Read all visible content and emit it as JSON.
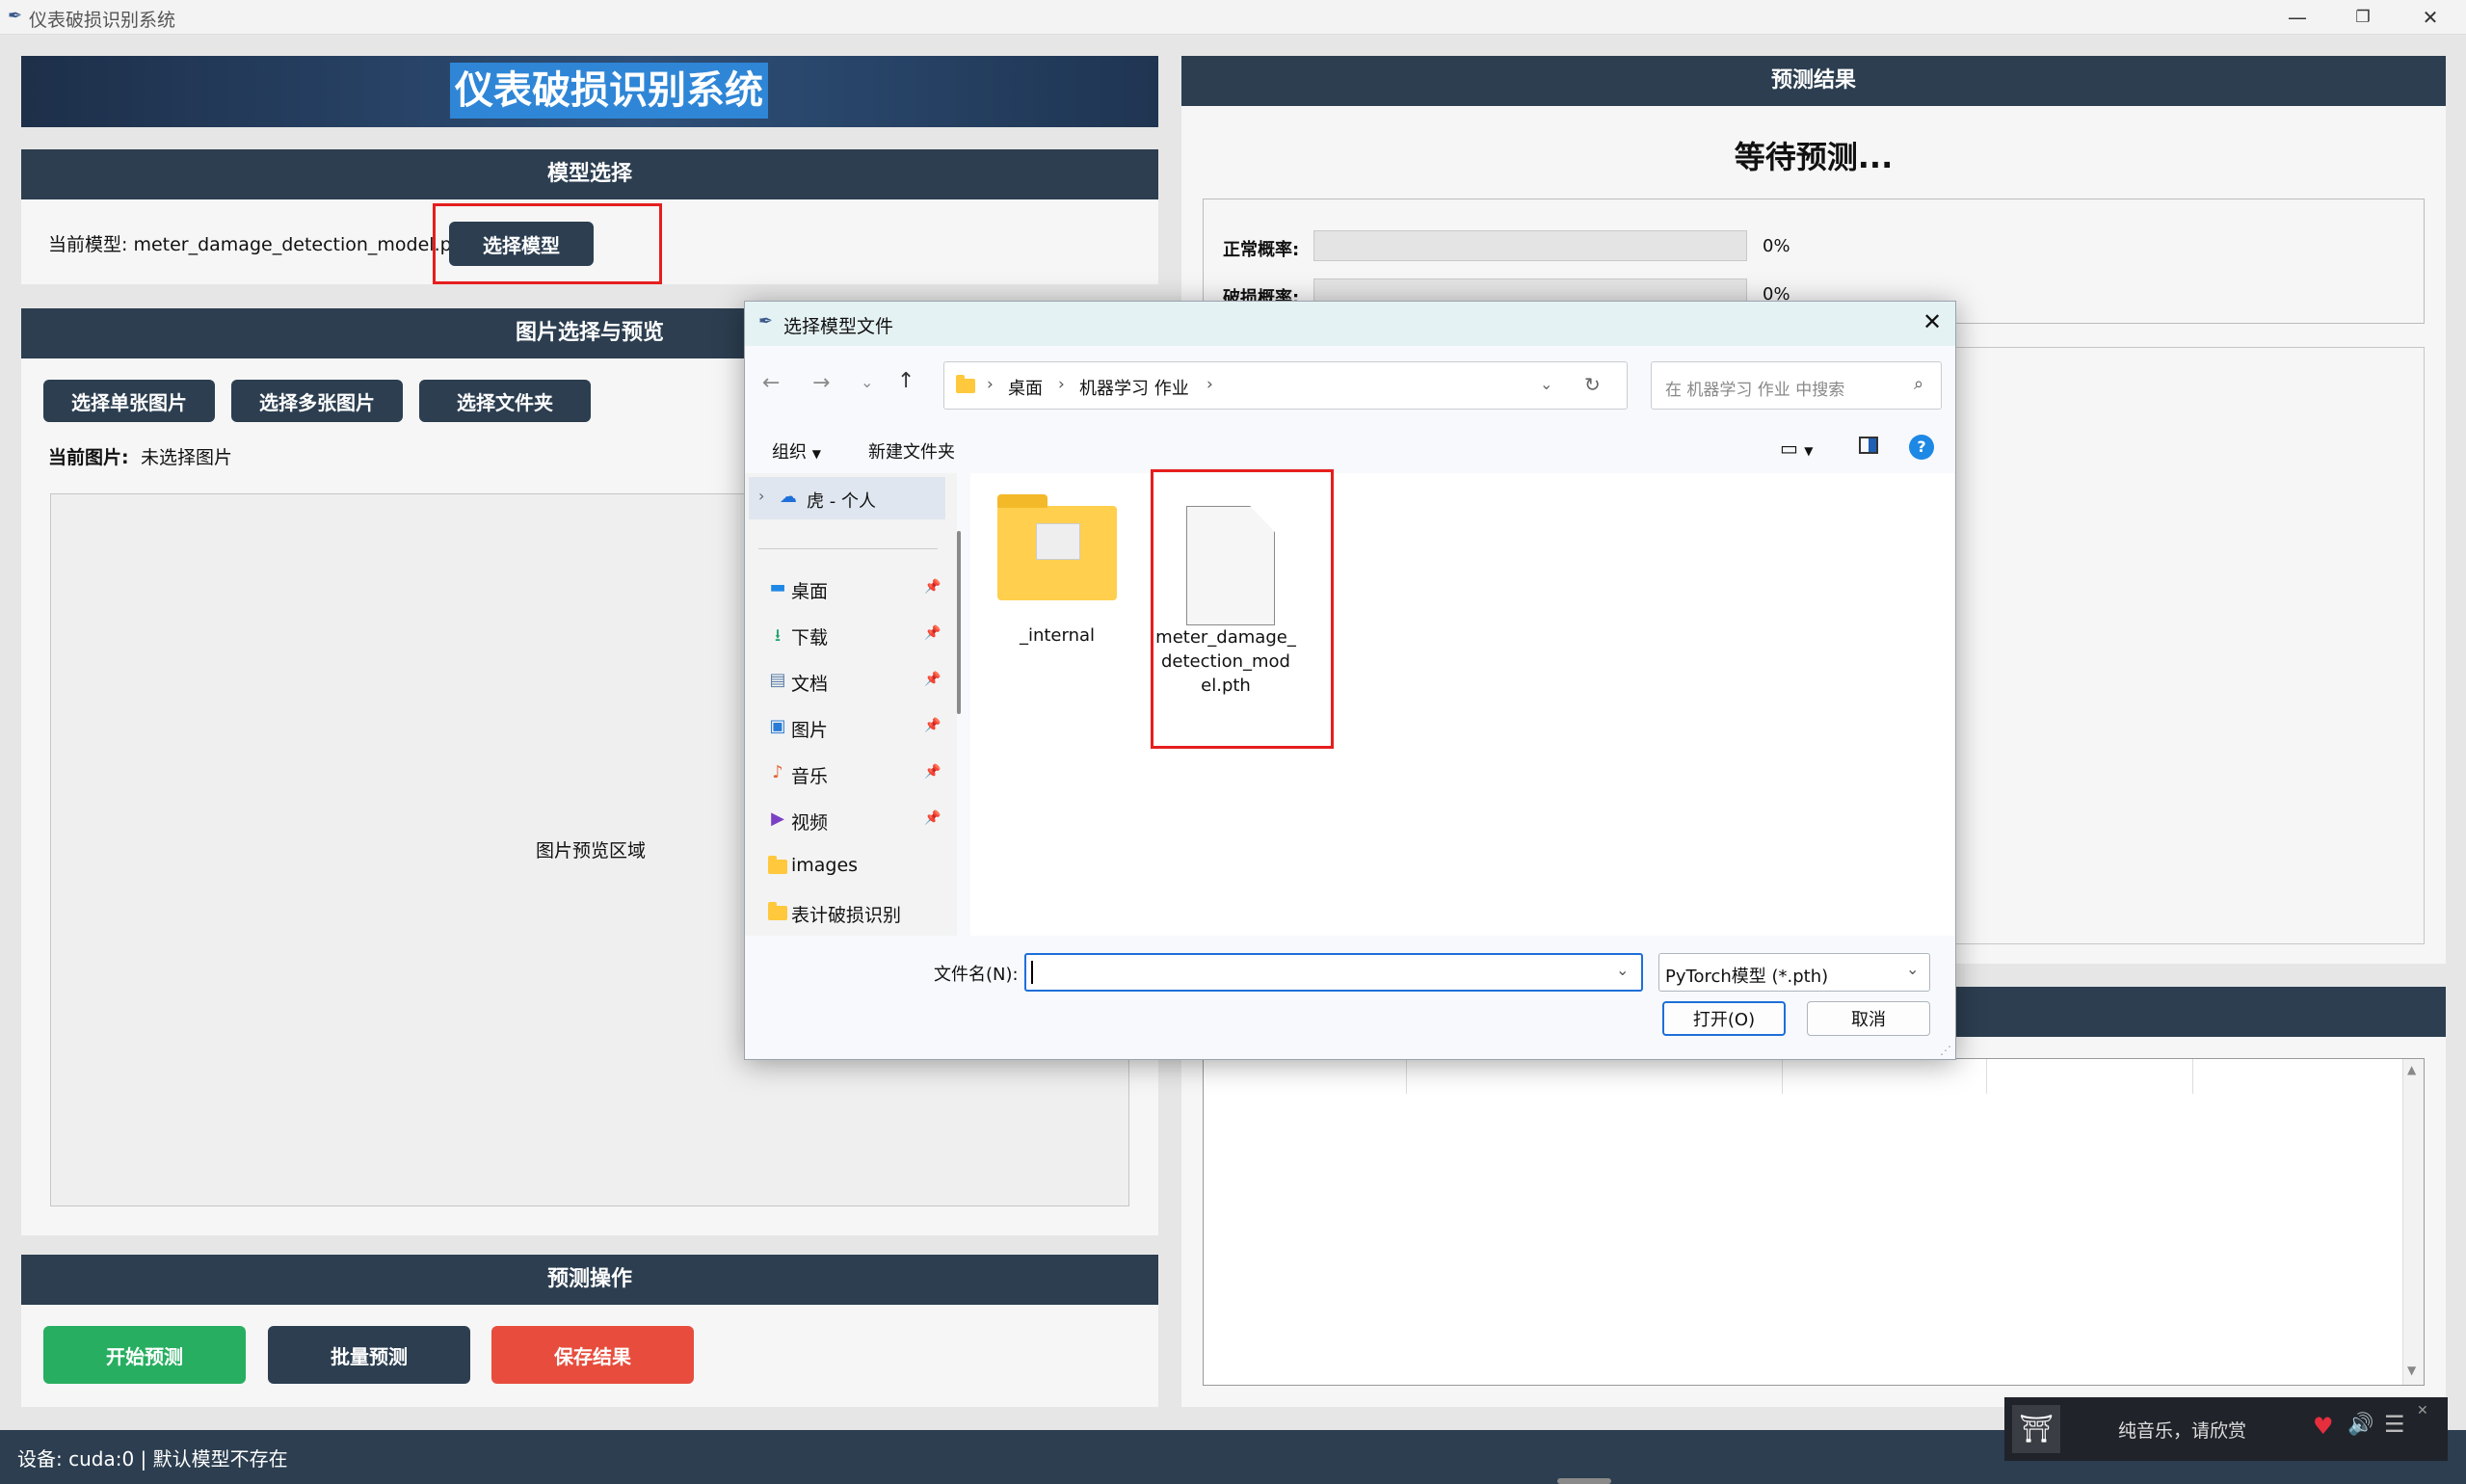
{
  "window": {
    "title": "仪表破损识别系统",
    "controls": {
      "minimize": "—",
      "maximize": "❐",
      "close": "✕"
    }
  },
  "app": {
    "banner_title": "仪表破损识别系统",
    "model_section": {
      "header": "模型选择",
      "current_model_label": "当前模型: meter_damage_detection_model.pth",
      "select_button": "选择模型"
    },
    "image_section": {
      "header": "图片选择与预览",
      "buttons": {
        "single": "选择单张图片",
        "multi": "选择多张图片",
        "folder": "选择文件夹"
      },
      "current_image_label": "当前图片:",
      "current_image_value": "未选择图片",
      "preview_placeholder": "图片预览区域"
    },
    "predict_section": {
      "header": "预测操作",
      "start": "开始预测",
      "batch": "批量预测",
      "save": "保存结果"
    },
    "result_section": {
      "header": "预测结果",
      "status": "等待预测...",
      "normal_label": "正常概率:",
      "normal_value": "0%",
      "normal_fraction": 0,
      "damaged_label": "破损概率:",
      "damaged_value": "0%",
      "damaged_fraction": 0
    },
    "status_bar": "设备: cuda:0 | 默认模型不存在"
  },
  "colors": {
    "header_bg": "#2c3e50",
    "start_btn": "#27ae60",
    "save_btn": "#e74c3c",
    "highlight": "#e61e1e"
  },
  "dialog": {
    "title": "选择模型文件",
    "breadcrumb": [
      "桌面",
      "机器学习 作业"
    ],
    "search_placeholder": "在 机器学习 作业 中搜索",
    "toolbar": {
      "organize": "组织",
      "new_folder": "新建文件夹"
    },
    "nav_top": "虎 - 个人",
    "nav": [
      {
        "label": "桌面",
        "icon": "desktop-icon",
        "pinned": true
      },
      {
        "label": "下载",
        "icon": "download-icon",
        "pinned": true
      },
      {
        "label": "文档",
        "icon": "document-icon",
        "pinned": true
      },
      {
        "label": "图片",
        "icon": "pictures-icon",
        "pinned": true
      },
      {
        "label": "音乐",
        "icon": "music-icon",
        "pinned": true
      },
      {
        "label": "视频",
        "icon": "video-icon",
        "pinned": true
      },
      {
        "label": "images",
        "icon": "folder-icon",
        "pinned": false
      },
      {
        "label": "表计破损识别",
        "icon": "folder-icon",
        "pinned": false
      }
    ],
    "files": [
      {
        "name": "_internal",
        "type": "folder"
      },
      {
        "name_lines": [
          "meter_damage_",
          "detection_mod",
          "el.pth"
        ],
        "type": "file"
      }
    ],
    "filename_label": "文件名(N):",
    "filename_value": "",
    "filter": "PyTorch模型 (*.pth)",
    "open": "打开(O)",
    "cancel": "取消"
  },
  "music_widget": {
    "text": "纯音乐，请欣赏"
  }
}
